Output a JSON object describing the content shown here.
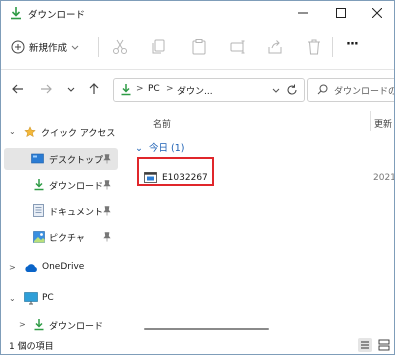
{
  "window": {
    "title": "ダウンロード",
    "controls": {
      "minimize": "–",
      "maximize": "□",
      "close": "✕"
    }
  },
  "commandbar": {
    "new_label": "新規作成",
    "items": [
      "cut-icon",
      "copy-icon",
      "paste-icon",
      "rename-icon",
      "share-icon",
      "delete-icon",
      "more-icon"
    ],
    "more_label": "···"
  },
  "navigation": {
    "back": "←",
    "forward": "→",
    "recent": "⌄",
    "up": "↑"
  },
  "address": {
    "sep1": ">",
    "part1": "PC",
    "sep2": ">",
    "part2": "ダウン...",
    "dropdown": "⌄",
    "refresh": "↻"
  },
  "search": {
    "placeholder": "ダウンロードの検索"
  },
  "sidebar": {
    "items": [
      {
        "label": "クイック アクセス",
        "chevron": "⌄"
      },
      {
        "label": "デスクトップ"
      },
      {
        "label": "ダウンロード"
      },
      {
        "label": "ドキュメント"
      },
      {
        "label": "ピクチャ"
      },
      {
        "label": "OneDrive",
        "chevron": ">"
      },
      {
        "label": "PC",
        "chevron": "⌄"
      },
      {
        "label": "ダウンロード",
        "chevron": ">"
      }
    ]
  },
  "content": {
    "columns": {
      "name": "名前",
      "modified": "更新"
    },
    "group": {
      "label": "今日 (1)",
      "chevron": "⌄"
    },
    "files": [
      {
        "name": "E1032267",
        "date": "2021/"
      }
    ]
  },
  "status": {
    "item_count": "1 個の項目"
  },
  "colors": {
    "accent": "#0067c0",
    "highlight_border": "#e0262b",
    "folder_green": "#2e9b45",
    "selected_bg": "#e5e5e5"
  }
}
